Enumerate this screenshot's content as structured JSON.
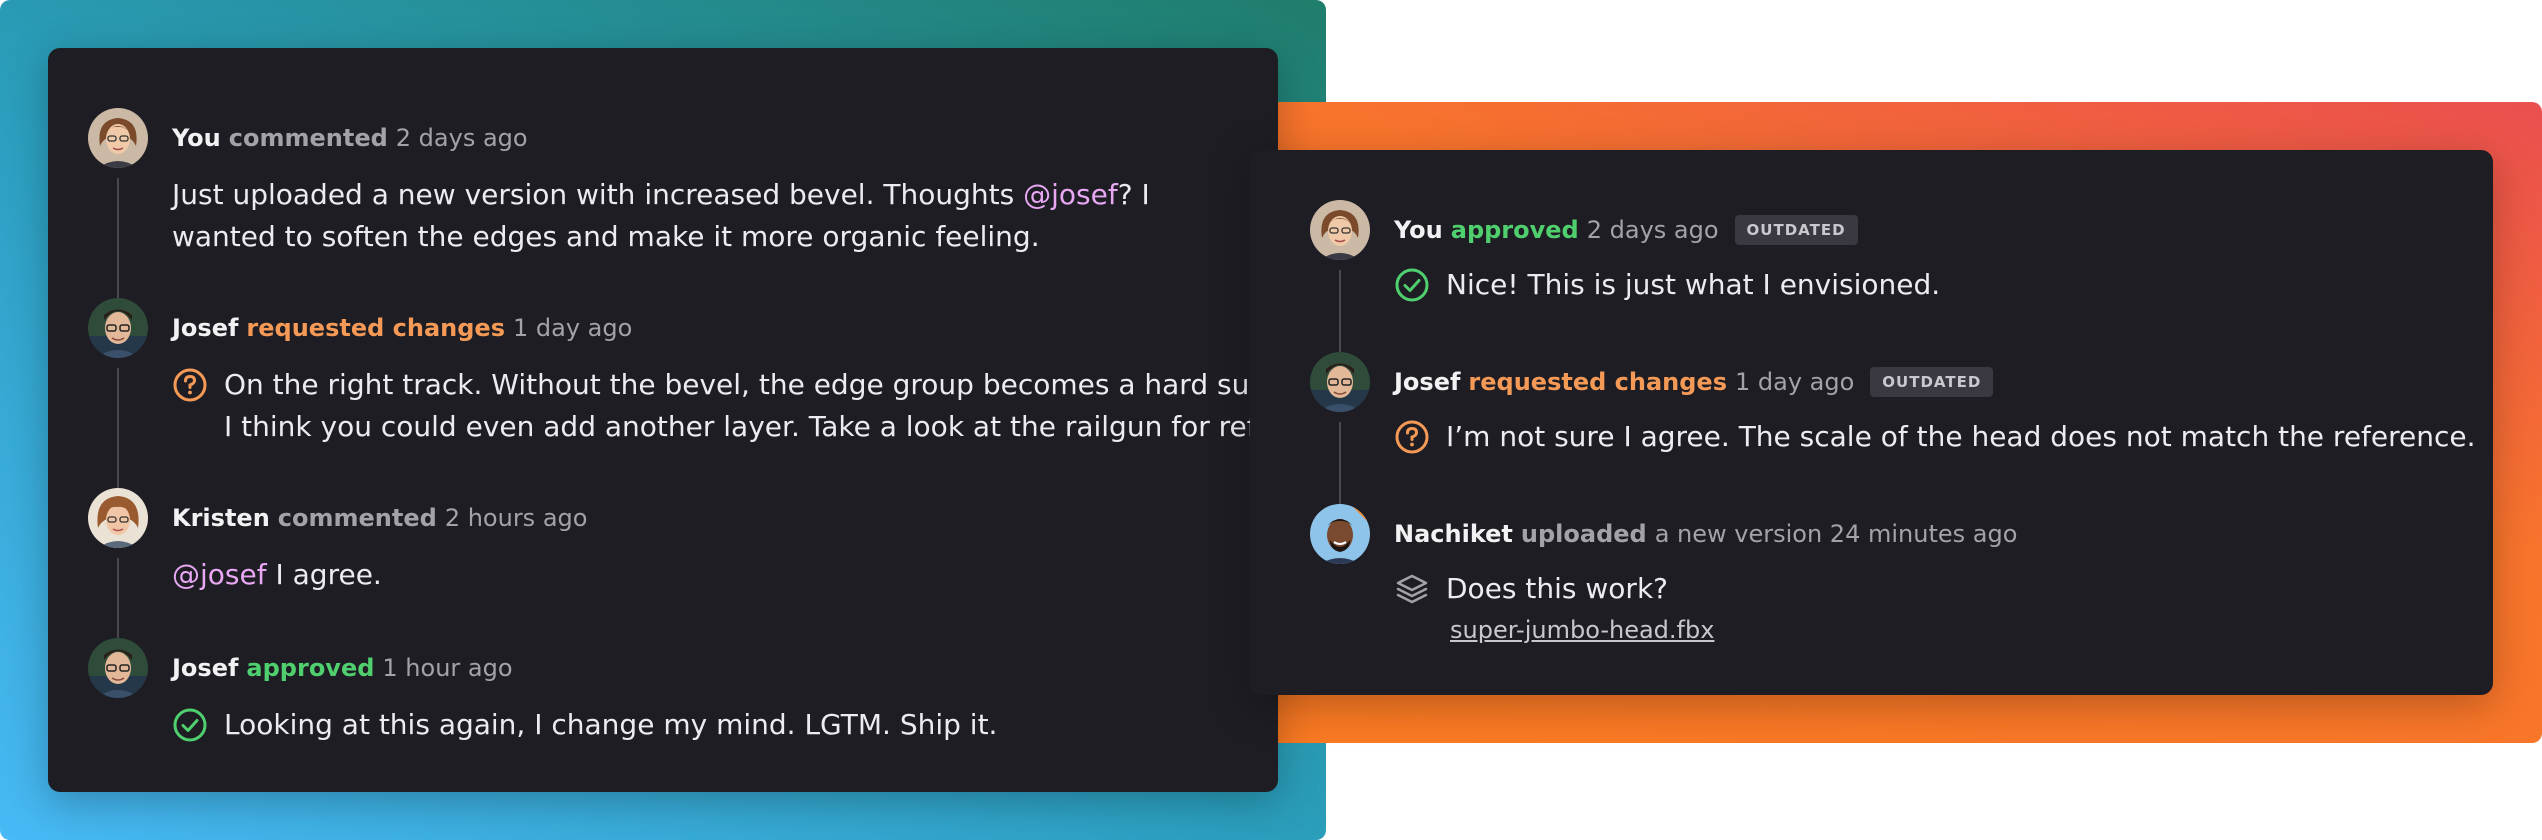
{
  "colors": {
    "left_frame_gradient": [
      "#47b9f5",
      "#1f7d6b"
    ],
    "right_frame_gradient": [
      "#fa7a22",
      "#ea4f4f"
    ],
    "panel": "#1e1d23",
    "requested_changes": "#f59a56",
    "approved": "#4fcf6d",
    "mention": "#e7a7f3"
  },
  "left_thread": [
    {
      "author": "You",
      "action": "commented",
      "time": "2 days ago",
      "avatar": "avatar-you",
      "text_line1_before": "Just uploaded a new version with increased bevel. Thoughts ",
      "text_line1_mention": "@josef",
      "text_line1_after": "? I",
      "text_line2": "wanted to soften the edges and make it more organic feeling."
    },
    {
      "author": "Josef",
      "action": "requested changes",
      "time": "1 day ago",
      "avatar": "avatar-josef",
      "icon": "question-circle-icon",
      "text_line1": "On the right track. Without the bevel, the edge group becomes a hard surface.",
      "text_line2": "I think you could even add another layer. Take a look at the railgun for ref."
    },
    {
      "author": "Kristen",
      "action": "commented",
      "time": "2 hours ago",
      "avatar": "avatar-kristen",
      "text_mention": "@josef",
      "text_after": " I agree."
    },
    {
      "author": "Josef",
      "action": "approved",
      "time": "1 hour ago",
      "avatar": "avatar-josef",
      "icon": "check-circle-icon",
      "text": "Looking at this again, I change my mind. LGTM. Ship it."
    }
  ],
  "right_thread": [
    {
      "author": "You",
      "action": "approved",
      "time": "2 days ago",
      "badge": "OUTDATED",
      "avatar": "avatar-you",
      "icon": "check-circle-icon",
      "text": "Nice! This is just what I envisioned."
    },
    {
      "author": "Josef",
      "action": "requested changes",
      "time": "1 day ago",
      "badge": "OUTDATED",
      "avatar": "avatar-josef",
      "icon": "question-circle-icon",
      "text": "I’m not sure I agree. The scale of the head does not match the reference."
    },
    {
      "author": "Nachiket",
      "action": "uploaded",
      "time": "a new version 24 minutes ago",
      "avatar": "avatar-nachiket",
      "icon": "layers-icon",
      "text": "Does this work?",
      "file": "super-jumbo-head.fbx"
    }
  ]
}
